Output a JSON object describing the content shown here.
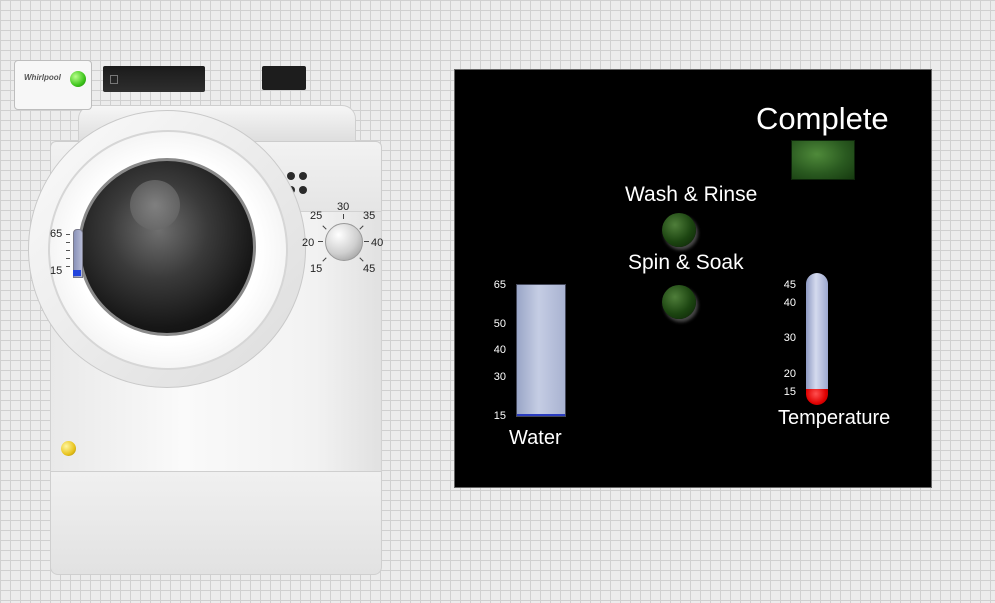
{
  "washer": {
    "brand": "Whirlpool",
    "water_scale": {
      "labels": [
        "65",
        "15"
      ],
      "level_fraction": 0.1
    },
    "temperature_dial": {
      "labels": [
        "15",
        "20",
        "25",
        "30",
        "35",
        "40",
        "45"
      ]
    }
  },
  "status_panel": {
    "complete_label": "Complete",
    "complete_on": false,
    "wash_rinse_label": "Wash & Rinse",
    "wash_rinse_on": false,
    "spin_soak_label": "Spin & Soak",
    "spin_soak_on": false,
    "water": {
      "title": "Water",
      "scale_labels": [
        "65",
        "50",
        "40",
        "30",
        "15"
      ],
      "value": 65
    },
    "temperature": {
      "title": "Temperature",
      "scale_labels": [
        "45",
        "40",
        "30",
        "20",
        "15"
      ],
      "value": 15
    }
  },
  "colors": {
    "panel_background": "#000000",
    "led_off": "#1c4511",
    "water_fill": "#b5bdd9",
    "thermo_red": "#e00000",
    "power_green": "#3ec51c"
  }
}
